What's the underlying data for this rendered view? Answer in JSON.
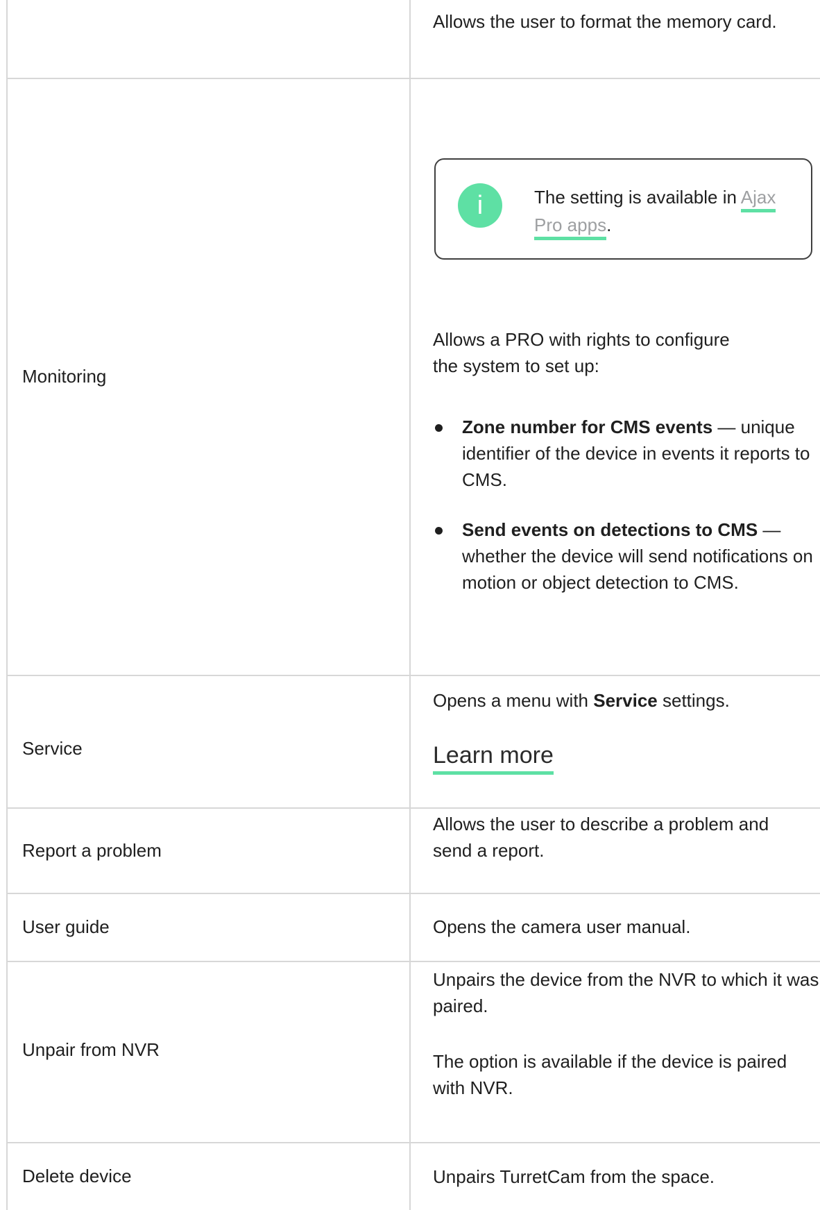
{
  "rows": [
    {
      "label": "",
      "desc": "Allows the user to format the memory card."
    },
    {
      "label": "Monitoring",
      "note": {
        "icon": "info-icon",
        "text_before": "The setting is available in ",
        "link": "Ajax Pro apps",
        "text_after": "."
      },
      "intro": "Allows a PRO with rights to configure the system to set up:",
      "bullets": [
        {
          "term": "Zone number for CMS events",
          "text": " — unique identifier of the device in events it reports to CMS."
        },
        {
          "term": "Send events on detections to CMS",
          "text": " — whether the device will send notifications on motion or object detection to CMS."
        }
      ]
    },
    {
      "label": "Service",
      "desc_before": "Opens a menu with ",
      "desc_bold": "Service",
      "desc_after": " settings.",
      "link": "Learn more"
    },
    {
      "label": "Report a problem",
      "desc": "Allows the user to describe a problem and send a report."
    },
    {
      "label": "User guide",
      "desc": "Opens the camera user manual."
    },
    {
      "label": "Unpair from NVR",
      "desc": "Unpairs the device from the NVR to which it was paired.",
      "desc2": "The option is available if the device is paired with NVR."
    },
    {
      "label": "Delete device",
      "desc": "Unpairs TurretCam from the space."
    }
  ],
  "colors": {
    "accent": "#5ee0a4",
    "border": "#d7d7d7",
    "text": "#1f1f1f",
    "link_gray": "#9ea0a2"
  }
}
